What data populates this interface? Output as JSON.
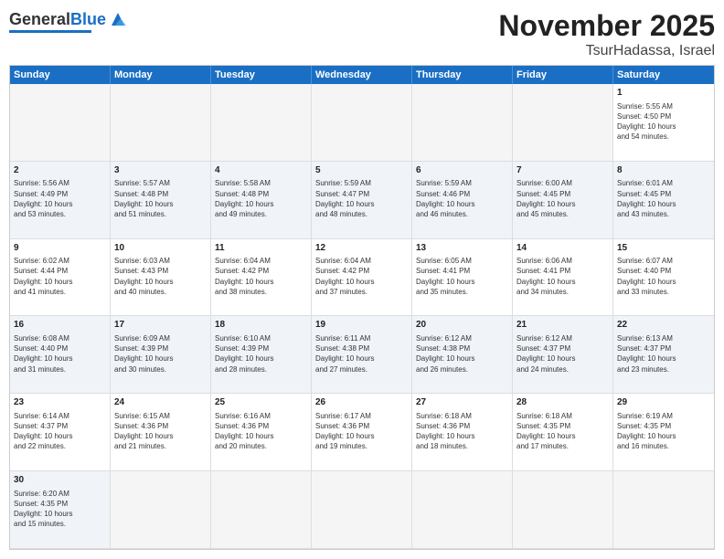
{
  "header": {
    "logo_general": "General",
    "logo_blue": "Blue",
    "month": "November 2025",
    "location": "TsurHadassa, Israel"
  },
  "days": [
    "Sunday",
    "Monday",
    "Tuesday",
    "Wednesday",
    "Thursday",
    "Friday",
    "Saturday"
  ],
  "cells": [
    {
      "date": "",
      "info": "",
      "empty": true
    },
    {
      "date": "",
      "info": "",
      "empty": true
    },
    {
      "date": "",
      "info": "",
      "empty": true
    },
    {
      "date": "",
      "info": "",
      "empty": true
    },
    {
      "date": "",
      "info": "",
      "empty": true
    },
    {
      "date": "",
      "info": "",
      "empty": true
    },
    {
      "date": "1",
      "info": "Sunrise: 5:55 AM\nSunset: 4:50 PM\nDaylight: 10 hours\nand 54 minutes."
    },
    {
      "date": "2",
      "info": "Sunrise: 5:56 AM\nSunset: 4:49 PM\nDaylight: 10 hours\nand 53 minutes."
    },
    {
      "date": "3",
      "info": "Sunrise: 5:57 AM\nSunset: 4:48 PM\nDaylight: 10 hours\nand 51 minutes."
    },
    {
      "date": "4",
      "info": "Sunrise: 5:58 AM\nSunset: 4:48 PM\nDaylight: 10 hours\nand 49 minutes."
    },
    {
      "date": "5",
      "info": "Sunrise: 5:59 AM\nSunset: 4:47 PM\nDaylight: 10 hours\nand 48 minutes."
    },
    {
      "date": "6",
      "info": "Sunrise: 5:59 AM\nSunset: 4:46 PM\nDaylight: 10 hours\nand 46 minutes."
    },
    {
      "date": "7",
      "info": "Sunrise: 6:00 AM\nSunset: 4:45 PM\nDaylight: 10 hours\nand 45 minutes."
    },
    {
      "date": "8",
      "info": "Sunrise: 6:01 AM\nSunset: 4:45 PM\nDaylight: 10 hours\nand 43 minutes."
    },
    {
      "date": "9",
      "info": "Sunrise: 6:02 AM\nSunset: 4:44 PM\nDaylight: 10 hours\nand 41 minutes."
    },
    {
      "date": "10",
      "info": "Sunrise: 6:03 AM\nSunset: 4:43 PM\nDaylight: 10 hours\nand 40 minutes."
    },
    {
      "date": "11",
      "info": "Sunrise: 6:04 AM\nSunset: 4:42 PM\nDaylight: 10 hours\nand 38 minutes."
    },
    {
      "date": "12",
      "info": "Sunrise: 6:04 AM\nSunset: 4:42 PM\nDaylight: 10 hours\nand 37 minutes."
    },
    {
      "date": "13",
      "info": "Sunrise: 6:05 AM\nSunset: 4:41 PM\nDaylight: 10 hours\nand 35 minutes."
    },
    {
      "date": "14",
      "info": "Sunrise: 6:06 AM\nSunset: 4:41 PM\nDaylight: 10 hours\nand 34 minutes."
    },
    {
      "date": "15",
      "info": "Sunrise: 6:07 AM\nSunset: 4:40 PM\nDaylight: 10 hours\nand 33 minutes."
    },
    {
      "date": "16",
      "info": "Sunrise: 6:08 AM\nSunset: 4:40 PM\nDaylight: 10 hours\nand 31 minutes."
    },
    {
      "date": "17",
      "info": "Sunrise: 6:09 AM\nSunset: 4:39 PM\nDaylight: 10 hours\nand 30 minutes."
    },
    {
      "date": "18",
      "info": "Sunrise: 6:10 AM\nSunset: 4:39 PM\nDaylight: 10 hours\nand 28 minutes."
    },
    {
      "date": "19",
      "info": "Sunrise: 6:11 AM\nSunset: 4:38 PM\nDaylight: 10 hours\nand 27 minutes."
    },
    {
      "date": "20",
      "info": "Sunrise: 6:12 AM\nSunset: 4:38 PM\nDaylight: 10 hours\nand 26 minutes."
    },
    {
      "date": "21",
      "info": "Sunrise: 6:12 AM\nSunset: 4:37 PM\nDaylight: 10 hours\nand 24 minutes."
    },
    {
      "date": "22",
      "info": "Sunrise: 6:13 AM\nSunset: 4:37 PM\nDaylight: 10 hours\nand 23 minutes."
    },
    {
      "date": "23",
      "info": "Sunrise: 6:14 AM\nSunset: 4:37 PM\nDaylight: 10 hours\nand 22 minutes."
    },
    {
      "date": "24",
      "info": "Sunrise: 6:15 AM\nSunset: 4:36 PM\nDaylight: 10 hours\nand 21 minutes."
    },
    {
      "date": "25",
      "info": "Sunrise: 6:16 AM\nSunset: 4:36 PM\nDaylight: 10 hours\nand 20 minutes."
    },
    {
      "date": "26",
      "info": "Sunrise: 6:17 AM\nSunset: 4:36 PM\nDaylight: 10 hours\nand 19 minutes."
    },
    {
      "date": "27",
      "info": "Sunrise: 6:18 AM\nSunset: 4:36 PM\nDaylight: 10 hours\nand 18 minutes."
    },
    {
      "date": "28",
      "info": "Sunrise: 6:18 AM\nSunset: 4:35 PM\nDaylight: 10 hours\nand 17 minutes."
    },
    {
      "date": "29",
      "info": "Sunrise: 6:19 AM\nSunset: 4:35 PM\nDaylight: 10 hours\nand 16 minutes."
    },
    {
      "date": "30",
      "info": "Sunrise: 6:20 AM\nSunset: 4:35 PM\nDaylight: 10 hours\nand 15 minutes."
    },
    {
      "date": "",
      "info": "",
      "empty": true
    },
    {
      "date": "",
      "info": "",
      "empty": true
    },
    {
      "date": "",
      "info": "",
      "empty": true
    },
    {
      "date": "",
      "info": "",
      "empty": true
    },
    {
      "date": "",
      "info": "",
      "empty": true
    },
    {
      "date": "",
      "info": "",
      "empty": true
    }
  ],
  "row_bg": [
    "#ffffff",
    "#f0f4f8",
    "#ffffff",
    "#f0f4f8",
    "#ffffff",
    "#f0f4f8"
  ]
}
